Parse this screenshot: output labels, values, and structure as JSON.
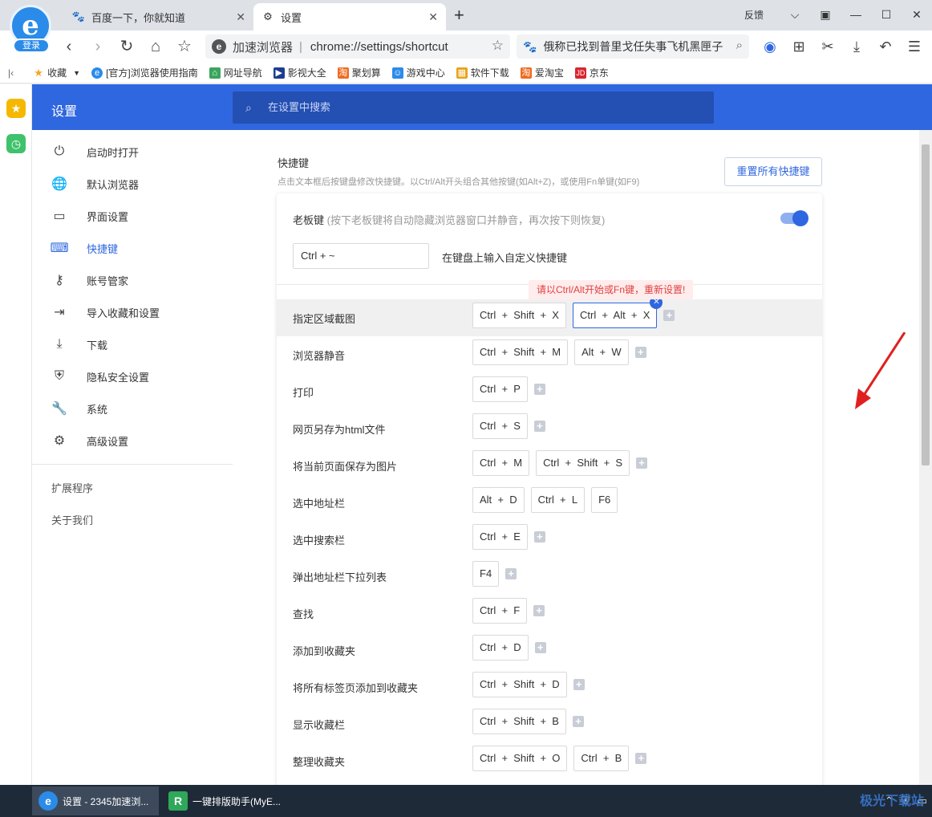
{
  "tabs": [
    {
      "title": "百度一下，你就知道",
      "icon": "baidu-paw-icon"
    },
    {
      "title": "设置",
      "icon": "gear-icon"
    }
  ],
  "window": {
    "feedback": "反馈",
    "avatar_login": "登录"
  },
  "address": {
    "brand": "加速浏览器",
    "separator": "|",
    "url": "chrome://settings/shortcut"
  },
  "search_bar": {
    "text": "俄称已找到普里戈任失事飞机黑匣子"
  },
  "bookmarks": [
    {
      "label": "收藏",
      "color": "#f5a623"
    },
    {
      "label": "[官方]浏览器使用指南",
      "color": "#2b8be8"
    },
    {
      "label": "网址导航",
      "color": "#3aa55d"
    },
    {
      "label": "影视大全",
      "color": "#1d3d8f"
    },
    {
      "label": "聚划算",
      "color": "#f06a20"
    },
    {
      "label": "游戏中心",
      "color": "#2b8be8"
    },
    {
      "label": "软件下载",
      "color": "#e8a21c"
    },
    {
      "label": "爱淘宝",
      "color": "#f06a20"
    },
    {
      "label": "京东",
      "color": "#d8262e"
    }
  ],
  "header": {
    "title": "设置",
    "search_placeholder": "在设置中搜索"
  },
  "sidenav": {
    "items": [
      {
        "label": "启动时打开",
        "icon": "power-icon",
        "glyph": "⏻"
      },
      {
        "label": "默认浏览器",
        "icon": "globe-icon",
        "glyph": "🌐"
      },
      {
        "label": "界面设置",
        "icon": "window-icon",
        "glyph": "▭"
      },
      {
        "label": "快捷键",
        "icon": "keyboard-icon",
        "glyph": "⌨",
        "active": true
      },
      {
        "label": "账号管家",
        "icon": "key-icon",
        "glyph": "⚷"
      },
      {
        "label": "导入收藏和设置",
        "icon": "import-icon",
        "glyph": "⇥"
      },
      {
        "label": "下载",
        "icon": "download-icon",
        "glyph": "⤓"
      },
      {
        "label": "隐私安全设置",
        "icon": "shield-icon",
        "glyph": "⛨"
      },
      {
        "label": "系统",
        "icon": "wrench-icon",
        "glyph": "🔧"
      },
      {
        "label": "高级设置",
        "icon": "gear-icon",
        "glyph": "⚙"
      }
    ],
    "extensions": "扩展程序",
    "about": "关于我们"
  },
  "shortcuts": {
    "title": "快捷键",
    "description": "点击文本框后按键盘修改快捷键。以Ctrl/Alt开头组合其他按键(如Alt+Z)，或使用Fn单键(如F9)",
    "reset_button": "重置所有快捷键",
    "boss_key": {
      "label": "老板键",
      "hint": "(按下老板键将自动隐藏浏览器窗口并静音，再次按下则恢复)",
      "value": "Ctrl + ~",
      "tip": "在键盘上输入自定义快捷键",
      "enabled": true
    },
    "warning": "请以Ctrl/Alt开始或Fn键，重新设置!",
    "rows": [
      {
        "label": "指定区域截图",
        "keys": [
          "Ctrl  +  Shift  +  X",
          "Ctrl  +  Alt  +  X"
        ],
        "editing": 1,
        "plus": true,
        "highlight": true
      },
      {
        "label": "浏览器静音",
        "keys": [
          "Ctrl  +  Shift  +  M",
          "Alt  +  W"
        ],
        "plus": true
      },
      {
        "label": "打印",
        "keys": [
          "Ctrl  +  P"
        ],
        "plus": true
      },
      {
        "label": "网页另存为html文件",
        "keys": [
          "Ctrl  +  S"
        ],
        "plus": true
      },
      {
        "label": "将当前页面保存为图片",
        "keys": [
          "Ctrl  +  M",
          "Ctrl  +  Shift  +  S"
        ],
        "plus": true
      },
      {
        "label": "选中地址栏",
        "keys": [
          "Alt  +  D",
          "Ctrl  +  L",
          "F6"
        ],
        "plus": false
      },
      {
        "label": "选中搜索栏",
        "keys": [
          "Ctrl  +  E"
        ],
        "plus": true
      },
      {
        "label": "弹出地址栏下拉列表",
        "keys": [
          "F4"
        ],
        "plus": true
      },
      {
        "label": "查找",
        "keys": [
          "Ctrl  +  F"
        ],
        "plus": true
      },
      {
        "label": "添加到收藏夹",
        "keys": [
          "Ctrl  +  D"
        ],
        "plus": true
      },
      {
        "label": "将所有标签页添加到收藏夹",
        "keys": [
          "Ctrl  +  Shift  +  D"
        ],
        "plus": true
      },
      {
        "label": "显示收藏栏",
        "keys": [
          "Ctrl  +  Shift  +  B"
        ],
        "plus": true
      },
      {
        "label": "整理收藏夹",
        "keys": [
          "Ctrl  +  Shift  +  O",
          "Ctrl  +  B"
        ],
        "plus": true
      }
    ]
  },
  "taskbar": {
    "tasks": [
      {
        "label": "设置 - 2345加速浏...",
        "icon": "browser-e-icon",
        "active": true
      },
      {
        "label": "一键排版助手(MyE...",
        "icon": "myeditor-icon",
        "active": false
      }
    ]
  },
  "watermark": "极光下载站"
}
